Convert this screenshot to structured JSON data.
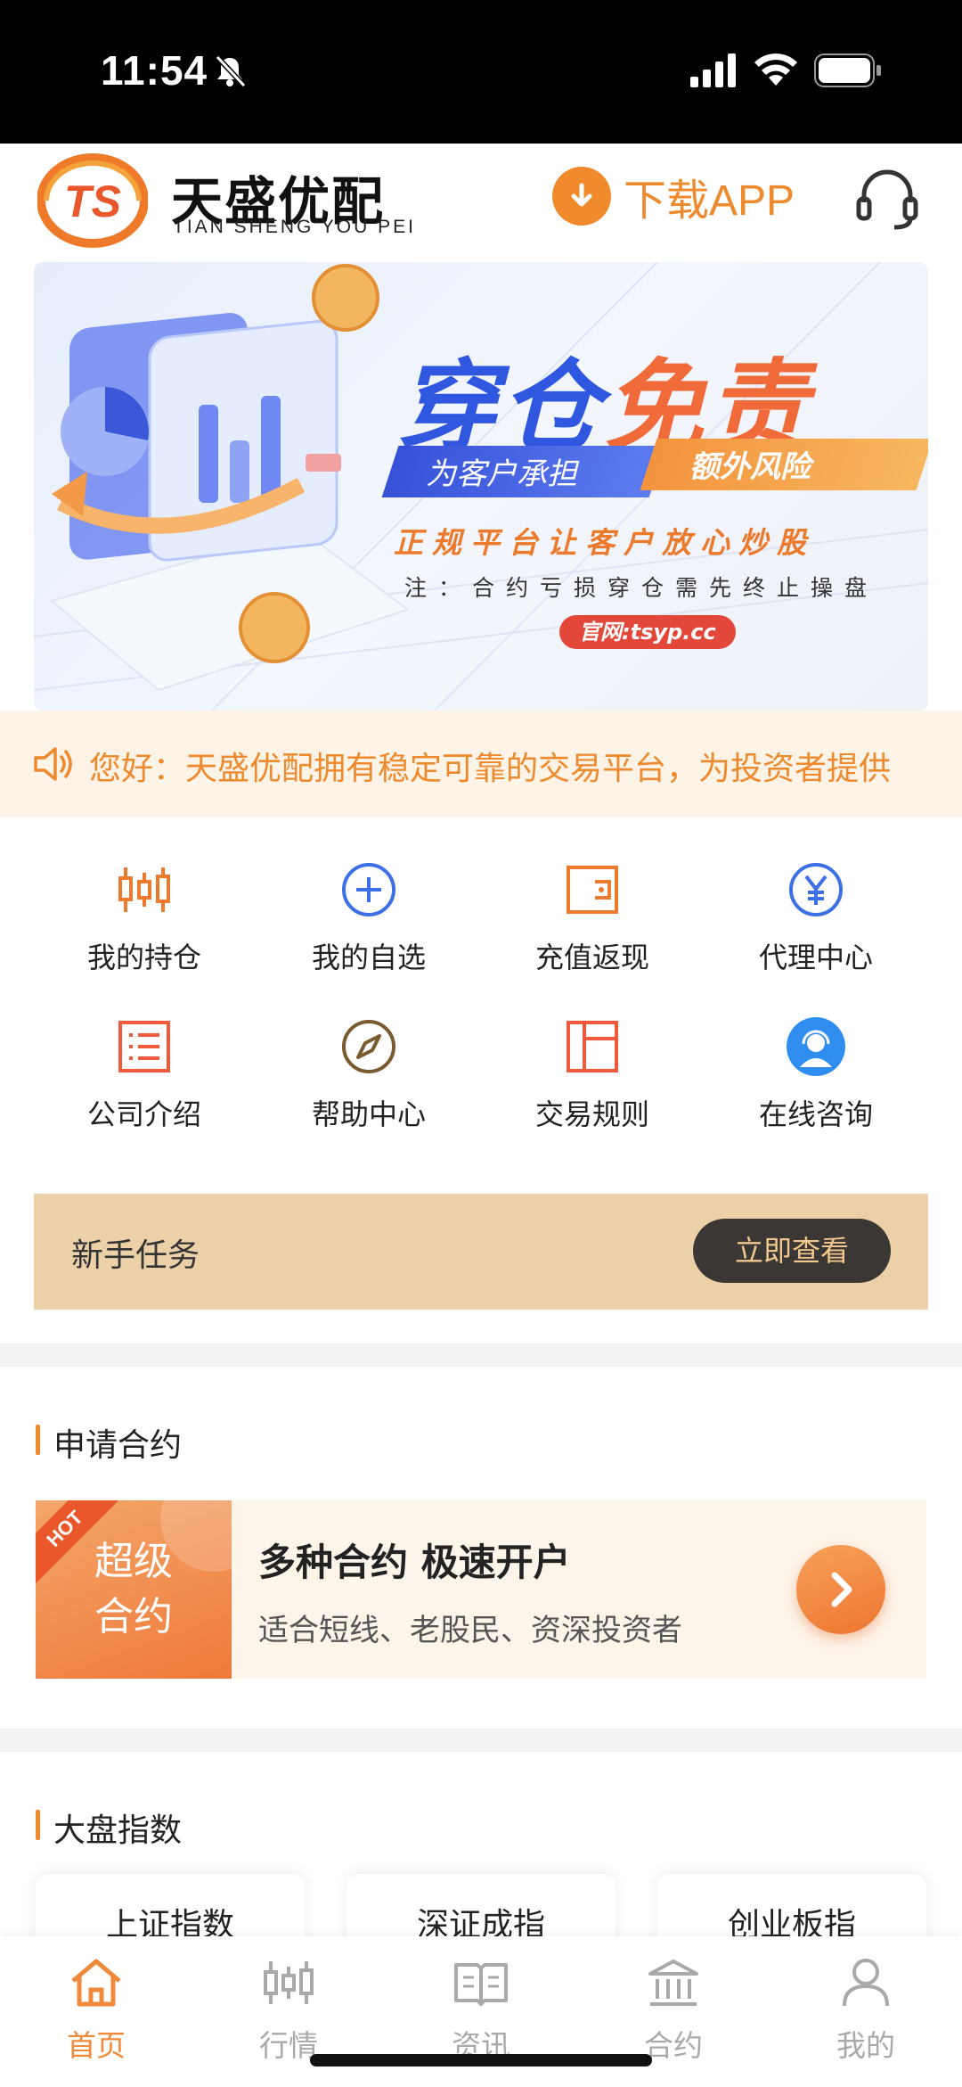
{
  "status_bar": {
    "time": "11:54",
    "icons": [
      "bell-slash-icon",
      "signal-icon",
      "wifi-icon",
      "battery-icon"
    ]
  },
  "header": {
    "brand_cn": "天盛优配",
    "brand_en": "TIAN SHENG YOU PEI",
    "logo_mark": "TS",
    "download_label": "下载APP",
    "accent": "#ee8a2e"
  },
  "banner": {
    "headline_a": "穿仓",
    "headline_b": "免责",
    "ribbon_left": "为客户承担",
    "ribbon_right": "额外风险",
    "slogan": "正规平台让客户放心炒股",
    "note": "注：合约亏损穿仓需先终止操盘",
    "site": "官网:tsyp.cc"
  },
  "notice": {
    "text": "您好：天盛优配拥有稳定可靠的交易平台，为投资者提供"
  },
  "menu": {
    "items": [
      {
        "label": "我的持仓",
        "icon": "candlestick-icon"
      },
      {
        "label": "我的自选",
        "icon": "plus-circle-icon"
      },
      {
        "label": "充值返现",
        "icon": "wallet-icon"
      },
      {
        "label": "代理中心",
        "icon": "yen-circle-icon"
      },
      {
        "label": "公司介绍",
        "icon": "list-icon"
      },
      {
        "label": "帮助中心",
        "icon": "compass-icon"
      },
      {
        "label": "交易规则",
        "icon": "layout-icon"
      },
      {
        "label": "在线咨询",
        "icon": "support-agent-icon"
      }
    ]
  },
  "task": {
    "title": "新手任务",
    "button": "立即查看"
  },
  "contract_section": {
    "title": "申请合约",
    "tag_hot": "HOT",
    "tag_line1": "超级",
    "tag_line2": "合约",
    "main": "多种合约 极速开户",
    "sub": "适合短线、老股民、资深投资者"
  },
  "index_section": {
    "title": "大盘指数",
    "cards": [
      "上证指数",
      "深证成指",
      "创业板指"
    ]
  },
  "tabbar": {
    "tabs": [
      {
        "label": "首页",
        "icon": "home-icon",
        "active": true
      },
      {
        "label": "行情",
        "icon": "candlestick-icon",
        "active": false
      },
      {
        "label": "资讯",
        "icon": "book-icon",
        "active": false
      },
      {
        "label": "合约",
        "icon": "bank-icon",
        "active": false
      },
      {
        "label": "我的",
        "icon": "user-icon",
        "active": false
      }
    ]
  }
}
